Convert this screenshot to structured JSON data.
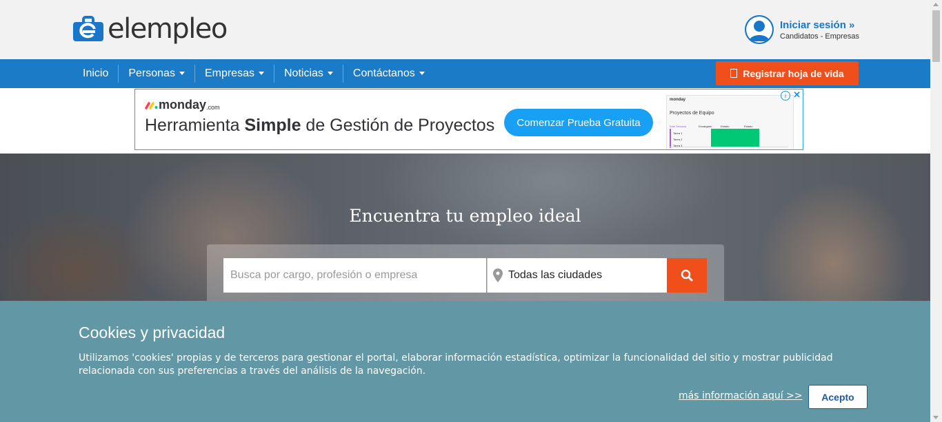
{
  "header": {
    "logo_text": "elempleo",
    "login_title": "Iniciar sesión »",
    "login_sub": "Candidatos - Empresas"
  },
  "nav": {
    "items": [
      {
        "label": "Inicio",
        "dropdown": false
      },
      {
        "label": "Personas",
        "dropdown": true
      },
      {
        "label": "Empresas",
        "dropdown": true
      },
      {
        "label": "Noticias",
        "dropdown": true
      },
      {
        "label": "Contáctanos",
        "dropdown": true
      }
    ],
    "cta_label": "Registrar hoja de vida"
  },
  "ad": {
    "brand": "monday",
    "brand_suffix": ".com",
    "headline_pre": "Herramienta ",
    "headline_bold": "Simple",
    "headline_post": " de Gestión de Proyectos",
    "cta": "Comenzar Prueba Gratuita",
    "preview_brand": "monday",
    "preview_title": "Proyectos de Equipo",
    "preview_cols": [
      "Este Semana",
      "Encargado",
      "Estado",
      "Estado"
    ],
    "preview_rows": [
      "Tarea 1",
      "Tarea 2",
      "Tarea 3"
    ]
  },
  "hero": {
    "title": "Encuentra tu empleo ideal",
    "search_placeholder": "Busca por cargo, profesión o empresa",
    "city_value": "Todas las ciudades"
  },
  "cookies": {
    "title": "Cookies y privacidad",
    "text": "Utilizamos 'cookies' propias y de terceros para gestionar el portal, elaborar información estadística, optimizar la funcionalidad del sitio y mostrar publicidad relacionada con sus preferencias a través del análisis de la navegación.",
    "more_link": "más información aquí >>",
    "accept": "Acepto"
  },
  "colors": {
    "brand_blue": "#1b7bc6",
    "cta_orange": "#f04e1b",
    "cookie_bg": "#6298a6"
  }
}
